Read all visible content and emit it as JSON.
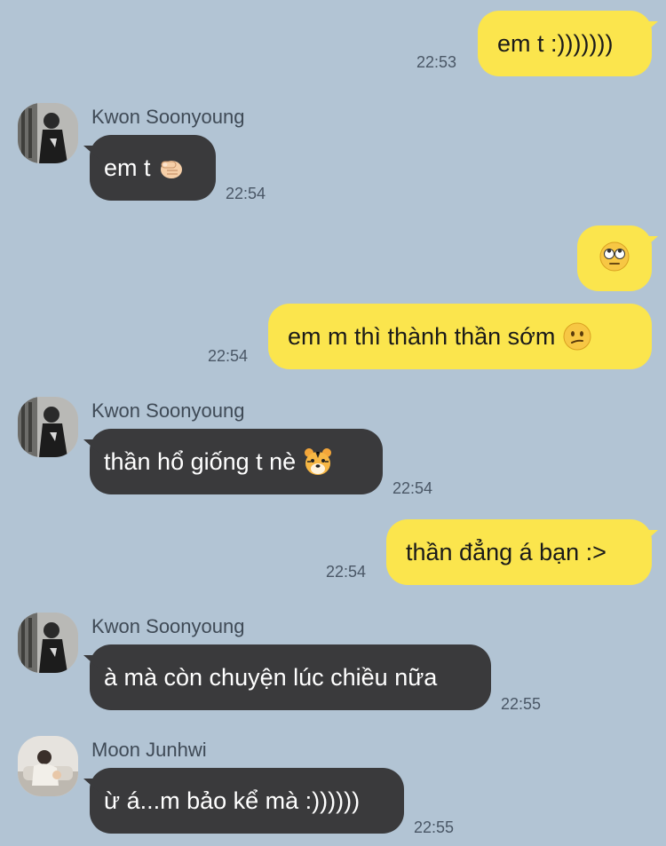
{
  "messages": [
    {
      "type": "outgoing",
      "text": "em t :)))))))",
      "time": "22:53"
    },
    {
      "type": "incoming",
      "sender": "Kwon Soonyoung",
      "text": "em t",
      "emoji": "pointing-finger-icon",
      "time": "22:54"
    },
    {
      "type": "outgoing",
      "text": "",
      "emoji": "eye-roll-face-icon"
    },
    {
      "type": "outgoing",
      "text": "em m thì thành thần sớm",
      "emoji": "confused-face-icon",
      "time": "22:54"
    },
    {
      "type": "incoming",
      "sender": "Kwon Soonyoung",
      "text": "thần hổ giống t nè",
      "emoji": "tiger-face-icon",
      "time": "22:54"
    },
    {
      "type": "outgoing",
      "text": "thần đẳng á bạn :>",
      "time": "22:54"
    },
    {
      "type": "incoming",
      "sender": "Kwon Soonyoung",
      "text": "à mà còn chuyện lúc chiều nữa",
      "time": "22:55"
    },
    {
      "type": "incoming",
      "sender": "Moon Junhwi",
      "text": "ừ á...m bảo kể mà :))))))",
      "time": "22:55"
    }
  ],
  "colors": {
    "background": "#b2c4d4",
    "outgoing_bubble": "#fbe54d",
    "incoming_bubble": "#3a3a3c"
  }
}
